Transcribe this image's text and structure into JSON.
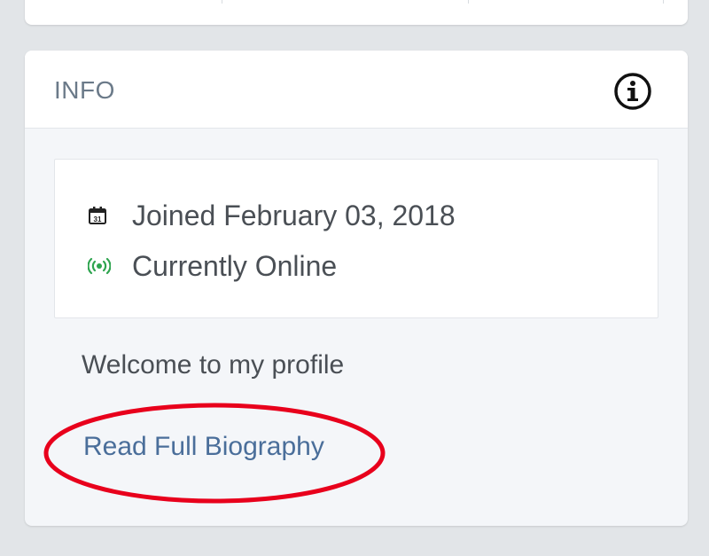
{
  "info_card": {
    "title": "INFO",
    "info_icon": "info-circle-icon",
    "details": {
      "joined": {
        "icon": "calendar-icon",
        "text": "Joined February 03, 2018"
      },
      "status": {
        "icon": "online-broadcast-icon",
        "text": "Currently Online",
        "color": "#2ea44f"
      }
    },
    "welcome": "Welcome to my profile",
    "bio_link": "Read Full Biography"
  },
  "colors": {
    "link": "#4a6e9a",
    "highlight": "#e8001c",
    "online": "#2ea44f"
  }
}
